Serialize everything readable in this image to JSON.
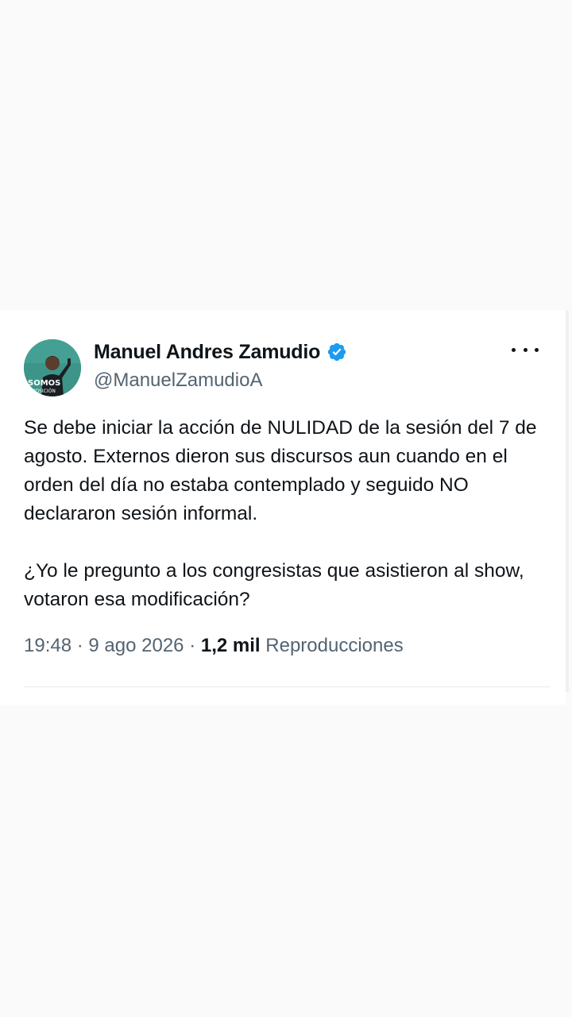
{
  "tweet": {
    "author": {
      "display_name": "Manuel Andres Zamudio",
      "handle": "@ManuelZamudioA",
      "verified": true,
      "avatar_text_top": "SOMOS",
      "avatar_text_bottom": "OPOSICIÓN"
    },
    "text_paragraphs": [
      "Se debe iniciar la acción de NULIDAD de la sesión del 7 de agosto. Externos dieron sus discursos aun cuando en el orden del día no estaba contemplado y seguido NO declararon sesión informal.",
      "¿Yo le pregunto a los congresistas que asistieron al show, votaron esa modificación?"
    ],
    "time": "19:48",
    "separator": "·",
    "date": "9 ago 2026",
    "views_count": "1,2 mil",
    "views_label": "Reproducciones"
  },
  "icons": {
    "verified": "verified-badge-icon",
    "more": "more-options-icon"
  },
  "colors": {
    "verified_blue": "#1d9bf0",
    "text_primary": "#0f1419",
    "text_secondary": "#536471",
    "background": "#fafafa",
    "card": "#ffffff"
  }
}
